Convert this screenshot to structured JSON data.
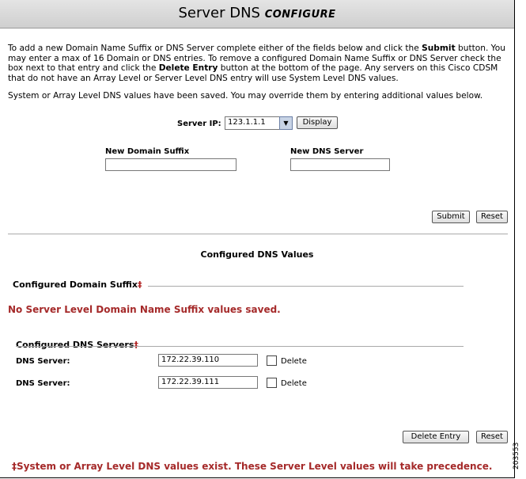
{
  "header": {
    "title": "Server DNS",
    "subtitle": "CONFIGURE"
  },
  "intro": {
    "part1": "To add a new Domain Name Suffix or DNS Server complete either of the fields below and click the ",
    "submit_word": "Submit",
    "part2": " button. You may enter a max of 16 Domain or DNS entries. To remove a configured Domain Name Suffix or DNS Server check the box next to that entry and click the ",
    "delete_word": "Delete Entry",
    "part3": " button at the bottom of the page. Any servers on this Cisco CDSM that do not have an Array Level or Server Level DNS entry will use System Level DNS values."
  },
  "saved_note": "System or Array Level DNS values have been saved. You may override them by entering additional values below.",
  "server_ip": {
    "label": "Server IP:",
    "selected": "123.1.1.1",
    "display_label": "Display"
  },
  "new_domain": {
    "label": "New Domain Suffix",
    "value": ""
  },
  "new_dns": {
    "label": "New DNS Server",
    "value": ""
  },
  "form_buttons": {
    "submit": "Submit",
    "reset": "Reset"
  },
  "configured": {
    "title": "Configured DNS Values",
    "domain_suffix_label": "Configured Domain Suffix",
    "dagger": "‡",
    "no_values": "No Server Level Domain Name Suffix values saved.",
    "dns_servers_label": "Configured DNS Servers",
    "servers": [
      {
        "label": "DNS Server:",
        "value": "172.22.39.110",
        "delete_label": "Delete"
      },
      {
        "label": "DNS Server:",
        "value": "172.22.39.111",
        "delete_label": "Delete"
      }
    ]
  },
  "bottom_buttons": {
    "delete_entry": "Delete Entry",
    "reset": "Reset"
  },
  "footnote": "‡System or Array Level DNS values exist. These Server Level values will take precedence.",
  "figure_id": "203553"
}
